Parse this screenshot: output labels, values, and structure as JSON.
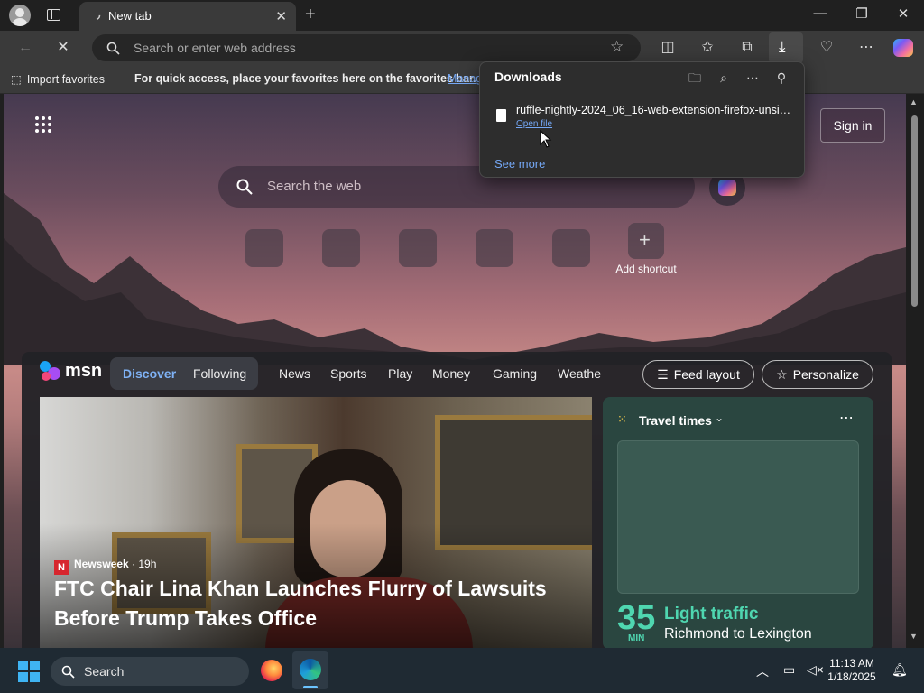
{
  "browser": {
    "tab_title": "New tab",
    "address_placeholder": "Search or enter web address"
  },
  "favorites_bar": {
    "import_label": "Import favorites",
    "message": "For quick access, place your favorites here on the favorites bar.",
    "manage_link": "Manag"
  },
  "downloads": {
    "title": "Downloads",
    "file_name": "ruffle-nightly-2024_06_16-web-extension-firefox-unsig...",
    "open_file": "Open file",
    "see_more": "See more"
  },
  "newtab": {
    "signin_label": "Sign in",
    "search_placeholder": "Search the web",
    "add_shortcut_label": "Add shortcut"
  },
  "msn": {
    "logo": "msn",
    "nav": [
      "Discover",
      "Following",
      "News",
      "Sports",
      "Play",
      "Money",
      "Gaming",
      "Weathe"
    ],
    "feed_layout_label": "Feed layout",
    "personalize_label": "Personalize",
    "hero": {
      "source": "Newsweek",
      "age": "· 19h",
      "headline": "FTC Chair Lina Khan Launches Flurry of Lawsuits Before Trump Takes Office"
    },
    "travel": {
      "title": "Travel times",
      "minutes": "35",
      "minutes_unit": "MIN",
      "status": "Light traffic",
      "route": "Richmond to Lexington"
    }
  },
  "taskbar": {
    "search_label": "Search",
    "time": "11:13 AM",
    "date": "1/18/2025"
  },
  "colors": {
    "link": "#74a7f5",
    "traffic_green": "#4fd6b0",
    "newsweek_red": "#d7262e"
  }
}
